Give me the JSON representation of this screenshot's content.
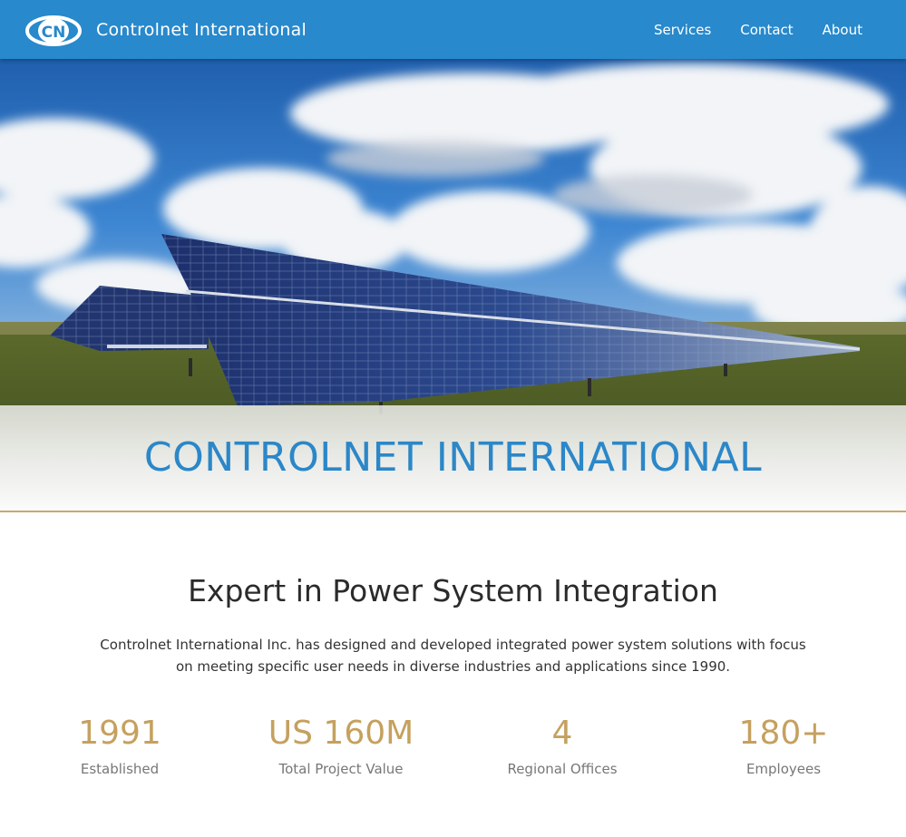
{
  "navbar": {
    "brand_name": "Controlnet International",
    "logo_mark": "CN",
    "links": [
      {
        "label": "Services"
      },
      {
        "label": "Contact"
      },
      {
        "label": "About"
      }
    ]
  },
  "hero": {
    "image": "solar-panel-field-photo",
    "title": "CONTROLNET INTERNATIONAL"
  },
  "intro": {
    "heading": "Expert in Power System Integration",
    "body": "Controlnet International Inc. has designed and developed integrated power system solutions with focus on meeting specific user needs in diverse industries and applications since 1990."
  },
  "stats": [
    {
      "value": "1991",
      "label": "Established"
    },
    {
      "value": "US 160M",
      "label": "Total Project Value"
    },
    {
      "value": "4",
      "label": "Regional Offices"
    },
    {
      "value": "180+",
      "label": "Employees"
    }
  ],
  "colors": {
    "navbar": "#2889cc",
    "hero_title": "#2b87c8",
    "accent_gold": "#c5a15f",
    "rule_gold": "#c8a96a"
  }
}
